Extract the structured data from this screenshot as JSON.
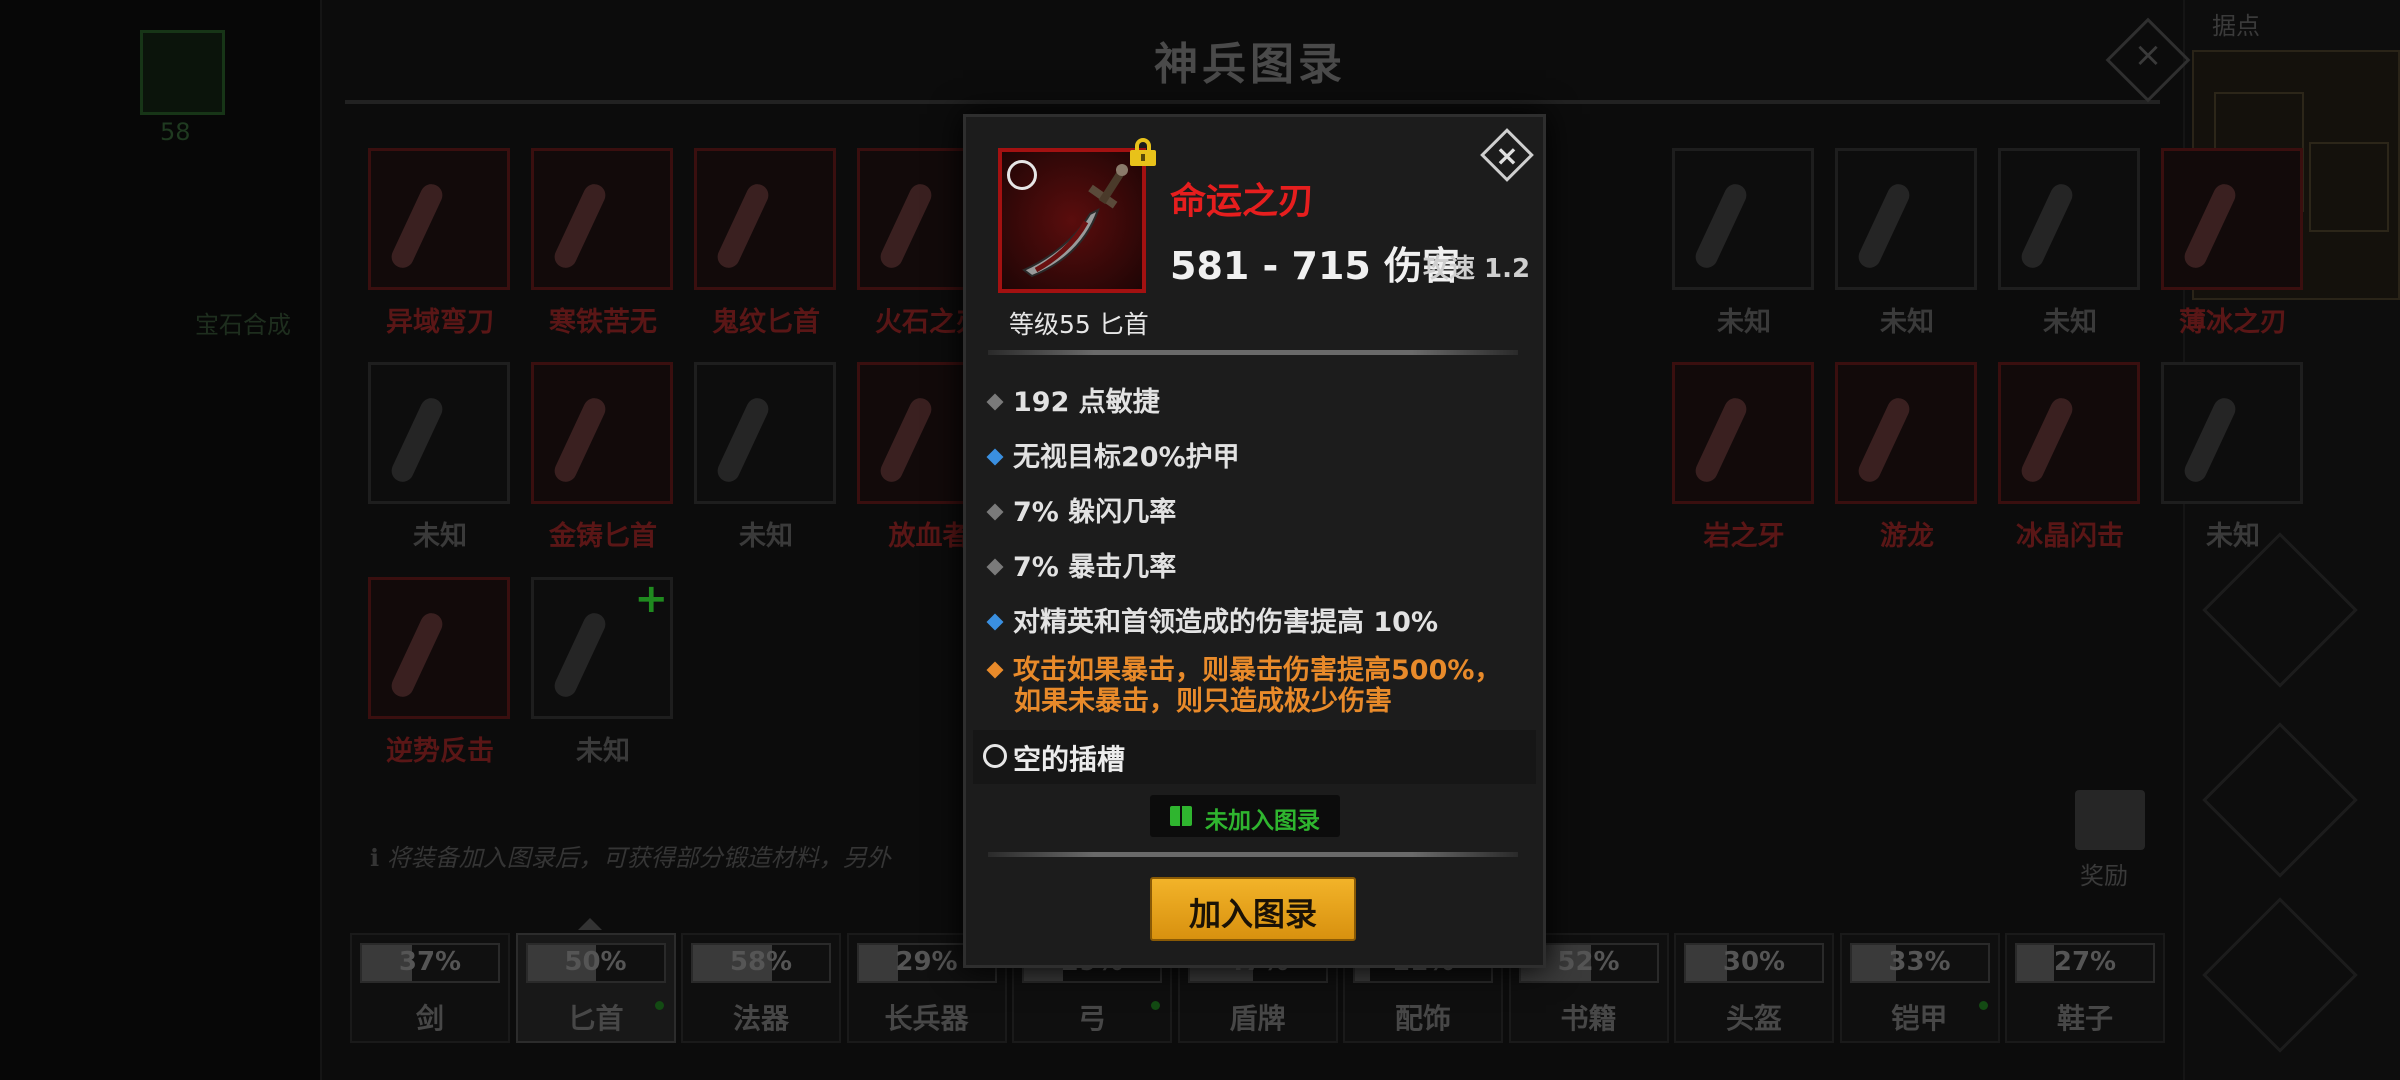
{
  "title": "神兵图录",
  "close_icon": "×",
  "minimap_label": "据点",
  "left_count": "58",
  "left_label": "宝石合成",
  "grid": {
    "row1": [
      {
        "name": "异域弯刀",
        "known": true
      },
      {
        "name": "寒铁苦无",
        "known": true
      },
      {
        "name": "鬼纹匕首",
        "known": true
      },
      {
        "name": "火石之刃",
        "known": true
      },
      {
        "name": "",
        "known": false
      },
      {
        "name": "",
        "known": false
      },
      {
        "name": "",
        "known": false
      },
      {
        "name": "",
        "known": false
      },
      {
        "name": "未知",
        "known": false
      },
      {
        "name": "未知",
        "known": false
      },
      {
        "name": "未知",
        "known": false
      },
      {
        "name": "薄冰之刃",
        "known": true
      }
    ],
    "row2": [
      {
        "name": "未知",
        "known": false
      },
      {
        "name": "金铸匕首",
        "known": true
      },
      {
        "name": "未知",
        "known": false
      },
      {
        "name": "放血者",
        "known": true
      },
      {
        "name": "",
        "known": false
      },
      {
        "name": "",
        "known": false
      },
      {
        "name": "",
        "known": false
      },
      {
        "name": "",
        "known": false
      },
      {
        "name": "岩之牙",
        "known": true
      },
      {
        "name": "游龙",
        "known": true
      },
      {
        "name": "冰晶闪击",
        "known": true
      },
      {
        "name": "未知",
        "known": false
      }
    ],
    "row3": [
      {
        "name": "逆势反击",
        "known": true
      },
      {
        "name": "未知",
        "known": false,
        "plus": true
      }
    ]
  },
  "info_text": "将装备加入图录后，可获得部分锻造材料，另外",
  "reward_label": "奖励",
  "tabs": [
    {
      "label": "剑",
      "pct": "37%",
      "value": 0.37
    },
    {
      "label": "匕首",
      "pct": "50%",
      "value": 0.5,
      "selected": true,
      "dot": true
    },
    {
      "label": "法器",
      "pct": "58%",
      "value": 0.58
    },
    {
      "label": "长兵器",
      "pct": "29%",
      "value": 0.29
    },
    {
      "label": "弓",
      "pct": "29%",
      "value": 0.29,
      "dot": true
    },
    {
      "label": "盾牌",
      "pct": "47%",
      "value": 0.47
    },
    {
      "label": "配饰",
      "pct": "11%",
      "value": 0.11
    },
    {
      "label": "书籍",
      "pct": "52%",
      "value": 0.52
    },
    {
      "label": "头盔",
      "pct": "30%",
      "value": 0.3
    },
    {
      "label": "铠甲",
      "pct": "33%",
      "value": 0.33,
      "dot": true
    },
    {
      "label": "鞋子",
      "pct": "27%",
      "value": 0.27
    }
  ],
  "popup": {
    "item_name": "命运之刃",
    "damage": "581 - 715 伤害",
    "speed": "攻速 1.2",
    "level": "等级55 匕首",
    "stats": [
      {
        "text": "192 点敏捷",
        "type": "normal"
      },
      {
        "text": "无视目标20%护甲",
        "type": "blue"
      },
      {
        "text": "7% 躲闪几率",
        "type": "normal"
      },
      {
        "text": "7% 暴击几率",
        "type": "normal"
      },
      {
        "text": "对精英和首领造成的伤害提高 10%",
        "type": "blue"
      },
      {
        "text": "攻击如果暴击，则暴击伤害提高500%，",
        "text2": "如果未暴击，则只造成极少伤害",
        "type": "orange"
      }
    ],
    "socket": "空的插槽",
    "status": "未加入图录",
    "add_button": "加入图录",
    "close": "×"
  },
  "colors": {
    "known": "#e61e1e",
    "green": "#2fb52f",
    "button": "#f2b329"
  }
}
